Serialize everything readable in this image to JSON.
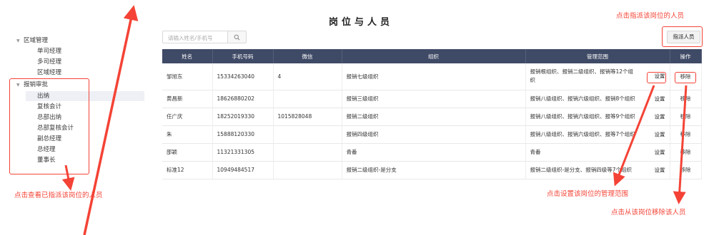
{
  "tree": {
    "groups": [
      {
        "label": "区域管理",
        "children": [
          "单司经理",
          "多司经理",
          "区域经理"
        ]
      },
      {
        "label": "报销审批",
        "children": [
          "出纳",
          "复核会计",
          "总部出纳",
          "总部复核会计",
          "副总经理",
          "总经理",
          "董事长"
        ]
      }
    ],
    "selected": "出纳"
  },
  "page_title": "岗位与人员",
  "search": {
    "placeholder": "请输入姓名/手机号"
  },
  "assign_button": "指派人员",
  "table": {
    "headers": [
      "姓名",
      "手机号码",
      "微信",
      "组织",
      "管理范围",
      "操作"
    ],
    "set_label": "设置",
    "remove_label": "移除",
    "rows": [
      {
        "name": "邹旭东",
        "phone": "15334263040",
        "wechat": "4",
        "org": "报销七级组织",
        "scope": "报销根组织、报销二级组织、报销等12个组织"
      },
      {
        "name": "黄昌新",
        "phone": "18626880202",
        "wechat": "",
        "org": "报销三级组织",
        "scope": "报销八级组织、报销六级组织、报销8个组织"
      },
      {
        "name": "任广庆",
        "phone": "18252019330",
        "wechat": "1015828048",
        "org": "报销二级组织",
        "scope": "报销八级组织、报销六级组织、报等9个组织"
      },
      {
        "name": "朱",
        "phone": "15888120330",
        "wechat": "",
        "org": "报销四级组织",
        "scope": "报销八级组织、报销六级组织、报等7个组织"
      },
      {
        "name": "邵颖",
        "phone": "11321331305",
        "wechat": "",
        "org": "青番",
        "scope": "青番"
      },
      {
        "name": "标准12",
        "phone": "10949484517",
        "wechat": "",
        "org": "报销二级组织-是分支",
        "scope": "报销二级组织-是分支、报销四级等7个组织"
      }
    ]
  },
  "annotations": {
    "assign": "点击指派该岗位的人员",
    "view": "点击查看已指派该岗位的人员",
    "set": "点击设置该岗位的管理范围",
    "remove": "点击从该岗位移除该人员"
  },
  "colors": {
    "header_bg": "#3f4a66",
    "annotation": "#f44336",
    "selected_bg": "#eef0f6"
  }
}
